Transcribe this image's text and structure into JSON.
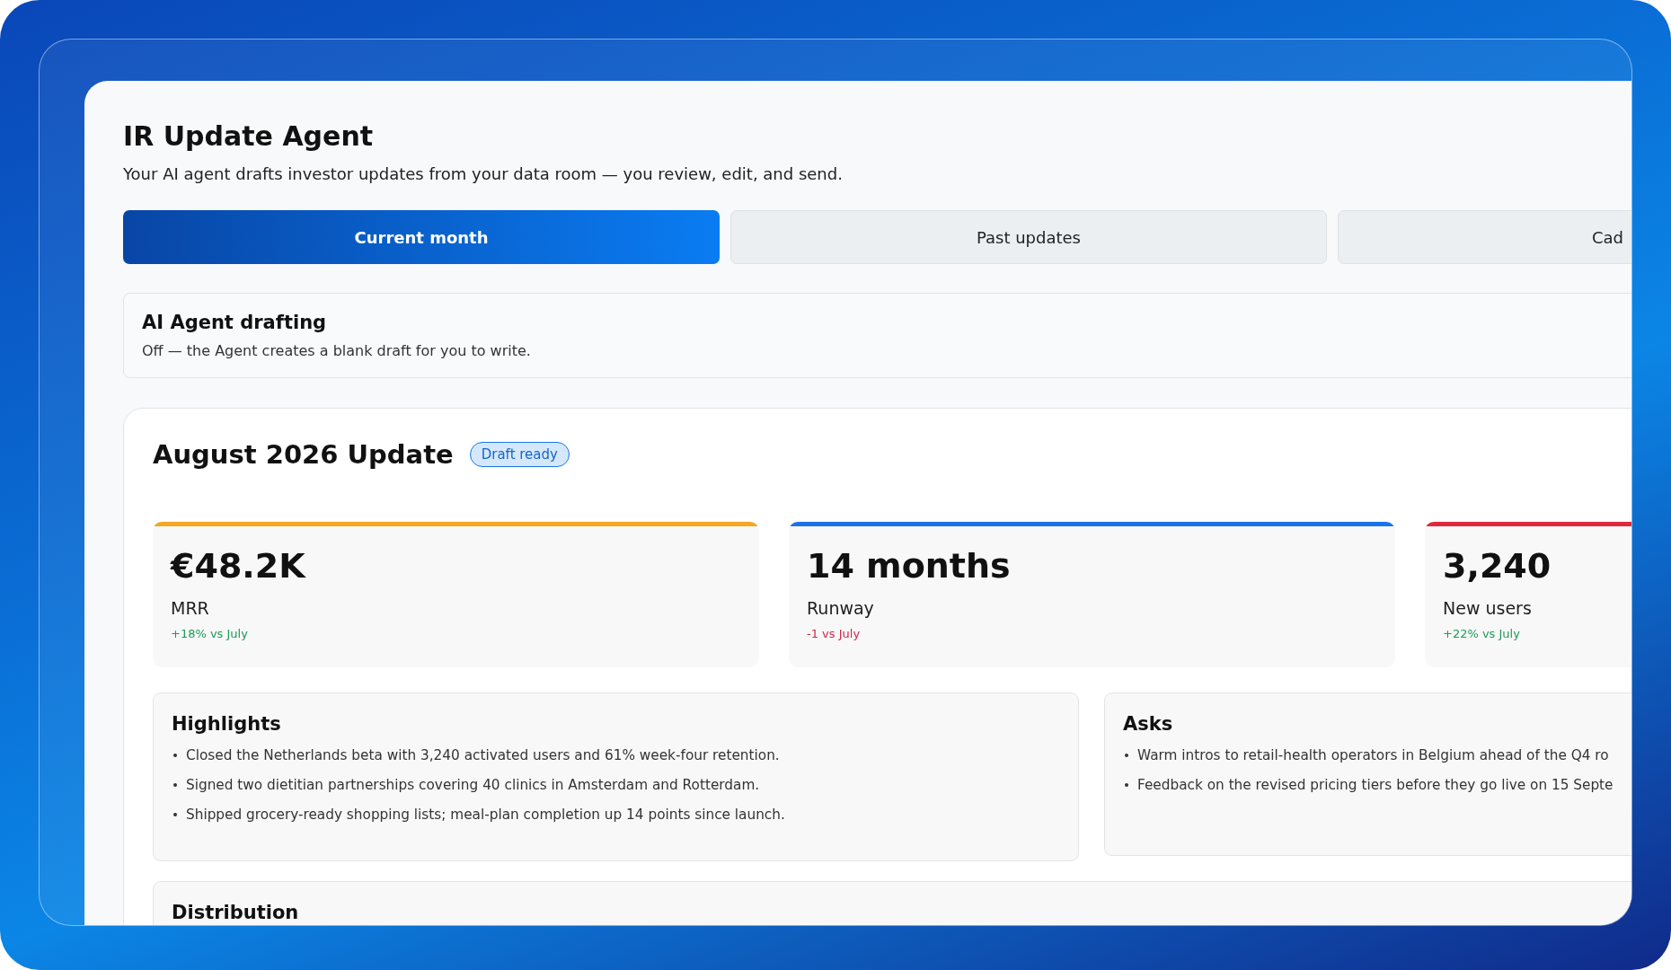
{
  "app": {
    "title": "IR Update Agent",
    "subtitle": "Your AI agent drafts investor updates from your data room — you review, edit, and send."
  },
  "tabs": [
    {
      "label": "Current month",
      "selected": true
    },
    {
      "label": "Past updates",
      "selected": false
    },
    {
      "label": "Cad",
      "selected": false
    }
  ],
  "drafting": {
    "title": "AI Agent drafting",
    "description": "Off — the Agent creates a blank draft for you to write."
  },
  "update": {
    "title": "August 2026 Update",
    "badge": "Draft ready",
    "metrics": [
      {
        "value": "€48.2K",
        "label": "MRR",
        "change": "+18% vs July",
        "positive": true,
        "color": "#f5a623"
      },
      {
        "value": "14 months",
        "label": "Runway",
        "change": "-1 vs July",
        "positive": false,
        "color": "#1a73e8"
      },
      {
        "value": "3,240",
        "label": "New users",
        "change": "+22% vs July",
        "positive": true,
        "color": "#e0283c"
      }
    ],
    "highlights": {
      "title": "Highlights",
      "items": [
        "Closed the Netherlands beta with 3,240 activated users and 61% week-four retention.",
        "Signed two dietitian partnerships covering 40 clinics in Amsterdam and Rotterdam.",
        "Shipped grocery-ready shopping lists; meal-plan completion up 14 points since launch."
      ]
    },
    "asks": {
      "title": "Asks",
      "items": [
        "Warm intros to retail-health operators in Belgium ahead of the Q4 ro",
        "Feedback on the revised pricing tiers before they go live on 15 Septe"
      ]
    },
    "distribution": {
      "title": "Distribution"
    }
  }
}
